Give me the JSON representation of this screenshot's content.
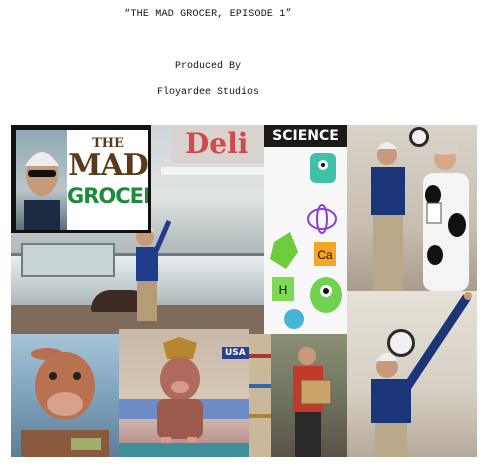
{
  "header": {
    "title": "“THE MAD GROCER, EPISODE 1”",
    "produced_by": "Produced By",
    "studio": "Floyardee Studios"
  },
  "collage": {
    "logo": {
      "line1": "THE",
      "line2": "MAD",
      "line3": "GROCER"
    },
    "store_sign": "Deli",
    "science_banner": "SCIENCE",
    "pig_scene_sign": "USA"
  }
}
